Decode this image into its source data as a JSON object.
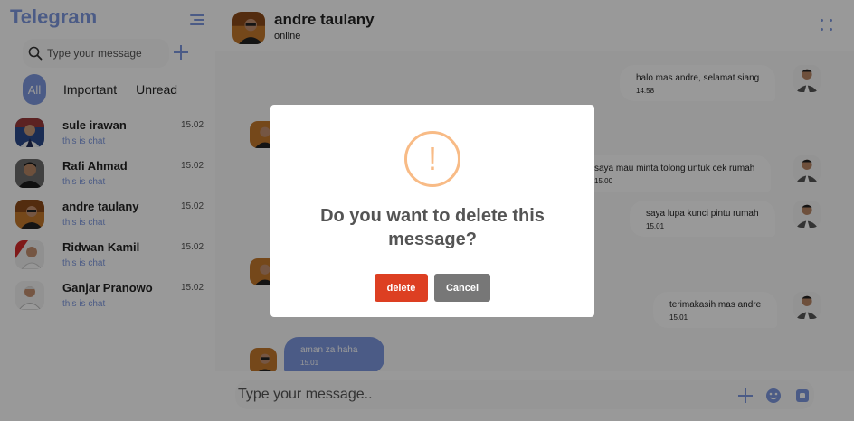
{
  "sidebar": {
    "brand": "Telegram",
    "search_placeholder": "Type your message",
    "tabs": [
      {
        "label": "All"
      },
      {
        "label": "Important"
      },
      {
        "label": "Unread"
      }
    ],
    "chats": [
      {
        "name": "sule irawan",
        "preview": "this is chat",
        "time": "15.02"
      },
      {
        "name": "Rafi Ahmad",
        "preview": "this is chat",
        "time": "15.02"
      },
      {
        "name": "andre taulany",
        "preview": "this is chat",
        "time": "15.02"
      },
      {
        "name": "Ridwan Kamil",
        "preview": "this is chat",
        "time": "15.02"
      },
      {
        "name": "Ganjar Pranowo",
        "preview": "this is chat",
        "time": "15.02"
      }
    ]
  },
  "header": {
    "name": "andre taulany",
    "status": "online"
  },
  "messages": [
    {
      "text": "halo mas andre, selamat siang",
      "time": "14.58",
      "direction": "out"
    },
    {
      "text": "saya mau minta tolong untuk cek rumah",
      "time": "15.00",
      "direction": "out"
    },
    {
      "text": "saya lupa kunci pintu rumah",
      "time": "15.01",
      "direction": "out"
    },
    {
      "text": "terimakasih mas andre",
      "time": "15.01",
      "direction": "out"
    },
    {
      "text": "aman za haha",
      "time": "15.01",
      "direction": "in"
    }
  ],
  "composer": {
    "placeholder": "Type your message.."
  },
  "dialog": {
    "icon": "!",
    "title": "Do you want to delete this message?",
    "confirm_label": "delete",
    "cancel_label": "Cancel"
  },
  "colors": {
    "accent": "#7e98df",
    "danger": "#dd3f22",
    "warning": "#f8bb86",
    "neutral_button": "#777777"
  }
}
